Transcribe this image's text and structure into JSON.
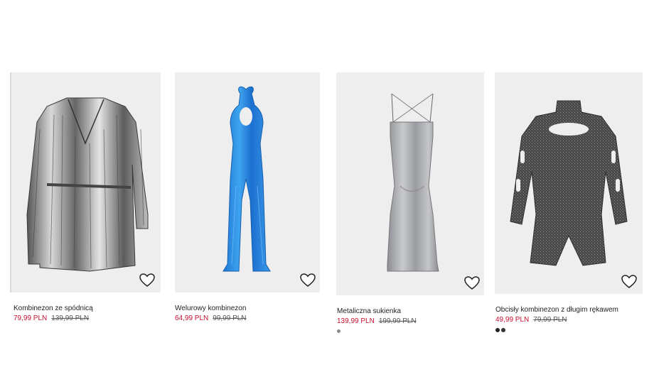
{
  "products": [
    {
      "name": "Kombinezon ze spódnicą",
      "price": "79,99 PLN",
      "old_price": "139,99 PLN",
      "image": "silver-metallic-wrap-playsuit",
      "colors": []
    },
    {
      "name": "Welurowy kombinezon",
      "price": "64,99 PLN",
      "old_price": "99,99 PLN",
      "image": "blue-velvet-halter-jumpsuit",
      "colors": []
    },
    {
      "name": "Metaliczna sukienka",
      "price": "139,99 PLN",
      "old_price": "199,99 PLN",
      "image": "silver-satin-slip-dress",
      "colors": [
        "#8a8a8a"
      ]
    },
    {
      "name": "Obcisły kombinezon z długim rękawem",
      "price": "49,99 PLN",
      "old_price": "79,99 PLN",
      "image": "glitter-cutout-bodysuit",
      "colors": [
        "#222222",
        "#333333"
      ]
    }
  ],
  "colors": {
    "sale_price": "#c8102e",
    "image_bg": "#eeeeee"
  },
  "icons": {
    "favorite": "heart-icon"
  }
}
